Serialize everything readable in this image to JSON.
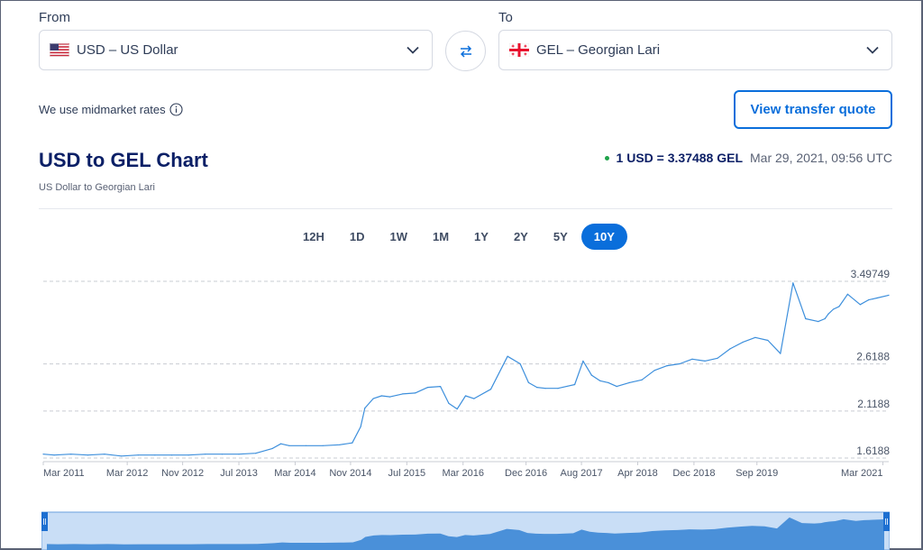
{
  "converter": {
    "from_label": "From",
    "to_label": "To",
    "from_currency": "USD – US Dollar",
    "to_currency": "GEL – Georgian Lari",
    "midmarket_text": "We use midmarket rates",
    "quote_button": "View transfer quote"
  },
  "header": {
    "title": "USD to GEL Chart",
    "subtitle": "US Dollar to Georgian Lari",
    "rate_value": "1 USD = 3.37488 GEL",
    "rate_time": "Mar 29, 2021, 09:56 UTC"
  },
  "tabs": [
    "12H",
    "1D",
    "1W",
    "1M",
    "1Y",
    "2Y",
    "5Y",
    "10Y"
  ],
  "active_tab": "10Y",
  "colors": {
    "accent": "#0a6edb",
    "title": "#0b1f66",
    "line": "#3d8fdc",
    "live": "#1fa34a"
  },
  "chart_data": {
    "type": "line",
    "ylim": [
      1.6188,
      3.49749
    ],
    "y_ticks": [
      "3.49749",
      "2.6188",
      "2.1188",
      "1.6188"
    ],
    "y_tick_values": [
      3.49749,
      2.6188,
      2.1188,
      1.6188
    ],
    "x_tick_labels": [
      "Mar 2011",
      "Mar 2012",
      "Nov 2012",
      "Jul 2013",
      "Mar 2014",
      "Nov 2014",
      "Jul 2015",
      "Mar 2016",
      "Dec 2016",
      "Aug 2017",
      "Apr 2018",
      "Dec 2018",
      "Sep 2019",
      "Mar 2021"
    ],
    "x_tick_years": [
      2011.17,
      2012.17,
      2012.83,
      2013.5,
      2014.17,
      2014.83,
      2015.5,
      2016.17,
      2016.92,
      2017.58,
      2018.25,
      2018.92,
      2019.67,
      2021.17
    ],
    "xlim": [
      2011.17,
      2021.24
    ],
    "grid": "dashed horizontal",
    "series": [
      {
        "x": [
          2011.17,
          2011.3,
          2011.5,
          2011.7,
          2011.9,
          2012.1,
          2012.3,
          2012.5,
          2012.7,
          2012.9,
          2013.1,
          2013.3,
          2013.5,
          2013.7,
          2013.9,
          2014.0,
          2014.1,
          2014.3,
          2014.5,
          2014.7,
          2014.85,
          2014.95,
          2015.0,
          2015.1,
          2015.2,
          2015.3,
          2015.45,
          2015.6,
          2015.75,
          2015.9,
          2016.0,
          2016.1,
          2016.2,
          2016.3,
          2016.5,
          2016.7,
          2016.85,
          2016.95,
          2017.05,
          2017.15,
          2017.3,
          2017.5,
          2017.6,
          2017.7,
          2017.8,
          2017.9,
          2018.0,
          2018.15,
          2018.3,
          2018.45,
          2018.6,
          2018.75,
          2018.9,
          2019.05,
          2019.2,
          2019.35,
          2019.5,
          2019.65,
          2019.8,
          2019.95,
          2020.1,
          2020.25,
          2020.4,
          2020.48,
          2020.52,
          2020.58,
          2020.65,
          2020.75,
          2020.9,
          2021.0,
          2021.05,
          2021.1,
          2021.24
        ],
        "y": [
          1.66,
          1.65,
          1.66,
          1.65,
          1.66,
          1.64,
          1.65,
          1.65,
          1.65,
          1.65,
          1.66,
          1.66,
          1.66,
          1.67,
          1.72,
          1.77,
          1.75,
          1.75,
          1.75,
          1.76,
          1.78,
          1.95,
          2.15,
          2.25,
          2.28,
          2.27,
          2.3,
          2.31,
          2.37,
          2.38,
          2.2,
          2.14,
          2.28,
          2.25,
          2.35,
          2.7,
          2.62,
          2.42,
          2.37,
          2.36,
          2.36,
          2.4,
          2.65,
          2.5,
          2.44,
          2.42,
          2.38,
          2.42,
          2.45,
          2.55,
          2.6,
          2.62,
          2.67,
          2.65,
          2.68,
          2.78,
          2.85,
          2.9,
          2.87,
          2.73,
          3.48,
          3.1,
          3.07,
          3.1,
          3.15,
          3.2,
          3.23,
          3.36,
          3.25,
          3.3,
          3.31,
          3.32,
          3.35
        ]
      }
    ]
  }
}
